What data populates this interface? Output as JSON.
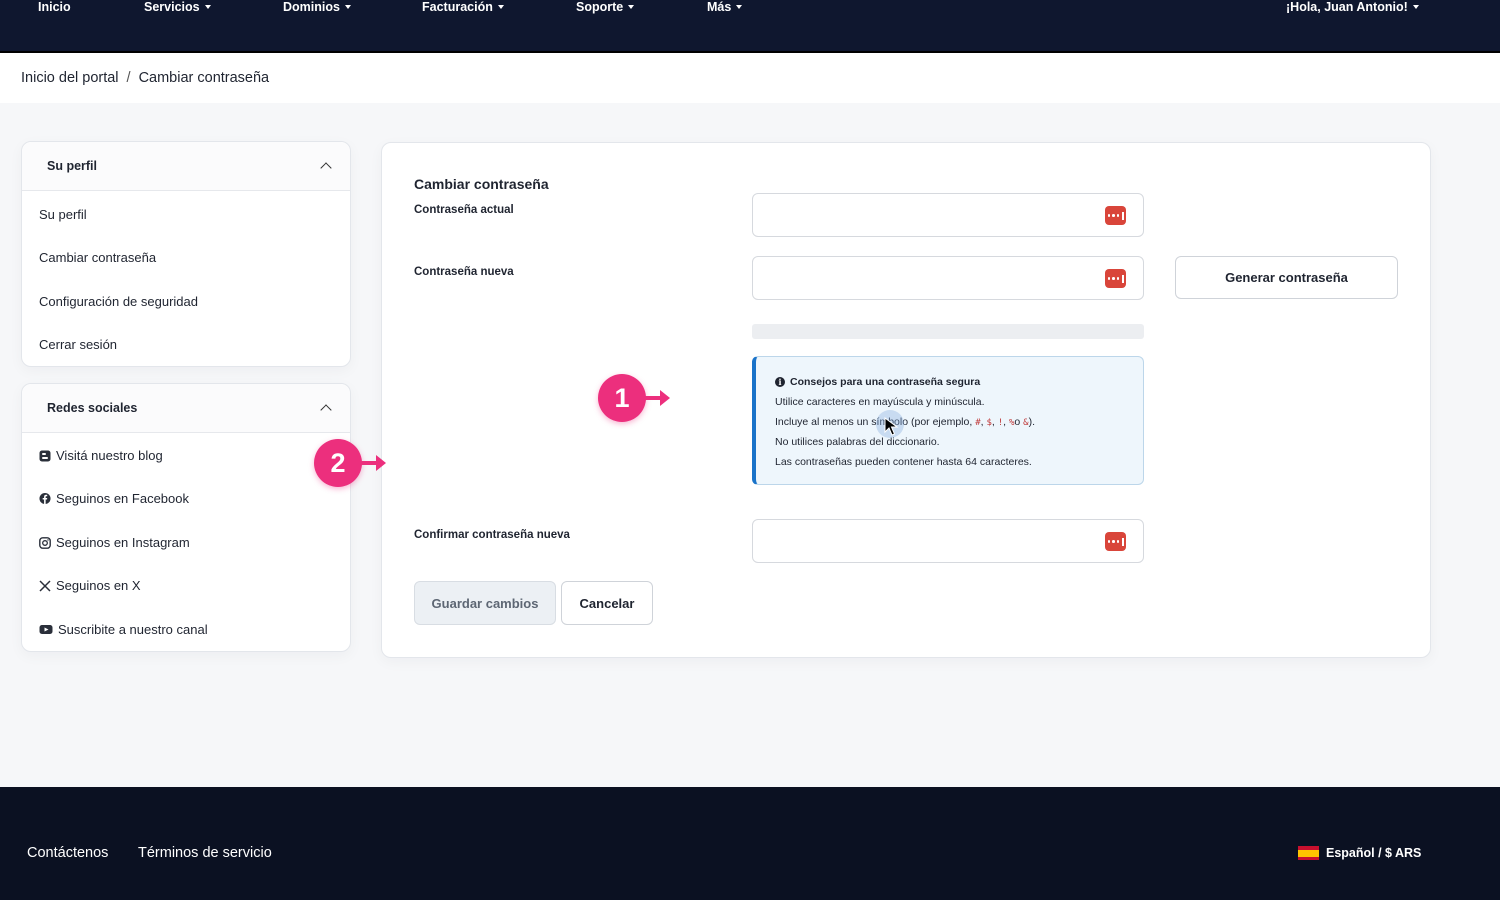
{
  "nav": {
    "home": "Inicio",
    "services": "Servicios",
    "domains": "Dominios",
    "billing": "Facturación",
    "support": "Soporte",
    "more": "Más",
    "greeting": "¡Hola, Juan Antonio!"
  },
  "breadcrumb": {
    "home": "Inicio del portal",
    "separator": "/",
    "current": "Cambiar contraseña"
  },
  "sidebar": {
    "profile": {
      "title": "Su perfil",
      "items": [
        {
          "label": "Su perfil"
        },
        {
          "label": "Cambiar contraseña"
        },
        {
          "label": "Configuración de seguridad"
        },
        {
          "label": "Cerrar sesión"
        }
      ]
    },
    "social": {
      "title": "Redes sociales",
      "items": [
        {
          "label": "Visitá nuestro blog",
          "icon": "blog-icon"
        },
        {
          "label": "Seguinos en Facebook",
          "icon": "facebook-icon"
        },
        {
          "label": "Seguinos en Instagram",
          "icon": "instagram-icon"
        },
        {
          "label": "Seguinos en X",
          "icon": "x-icon"
        },
        {
          "label": "Suscribite a nuestro canal",
          "icon": "youtube-icon"
        }
      ]
    }
  },
  "form": {
    "title": "Cambiar contraseña",
    "current_label": "Contraseña actual",
    "new_label": "Contraseña nueva",
    "confirm_label": "Confirmar contraseña nueva",
    "generate_label": "Generar contraseña",
    "save_label": "Guardar cambios",
    "cancel_label": "Cancelar",
    "current_value": "",
    "new_value": "",
    "confirm_value": ""
  },
  "tips": {
    "title": "Consejos para una contraseña segura",
    "line1": "Utilice caracteres en mayúscula y minúscula.",
    "line2_pre": "Incluye al menos un símbolo (por ejemplo, ",
    "sym1": "#",
    "sep1": ", ",
    "sym2": "$",
    "sep2": ", ",
    "sym3": "!",
    "sep3": ", ",
    "sym4": "%",
    "sep4": "o ",
    "sym5": "&",
    "line2_post": ").",
    "line3": "No utilices palabras del diccionario.",
    "line4": "Las contraseñas pueden contener hasta 64 caracteres."
  },
  "annotations": {
    "badge1": "1",
    "badge2": "2"
  },
  "footer": {
    "contact": "Contáctenos",
    "terms": "Términos de servicio",
    "language": "Español / $ ARS"
  },
  "colors": {
    "nav_bg": "#0f172f",
    "footer_bg": "#0b1122",
    "badge": "#ec2f7d",
    "tip_accent": "#1a73c9",
    "key_icon": "#d9453a"
  }
}
